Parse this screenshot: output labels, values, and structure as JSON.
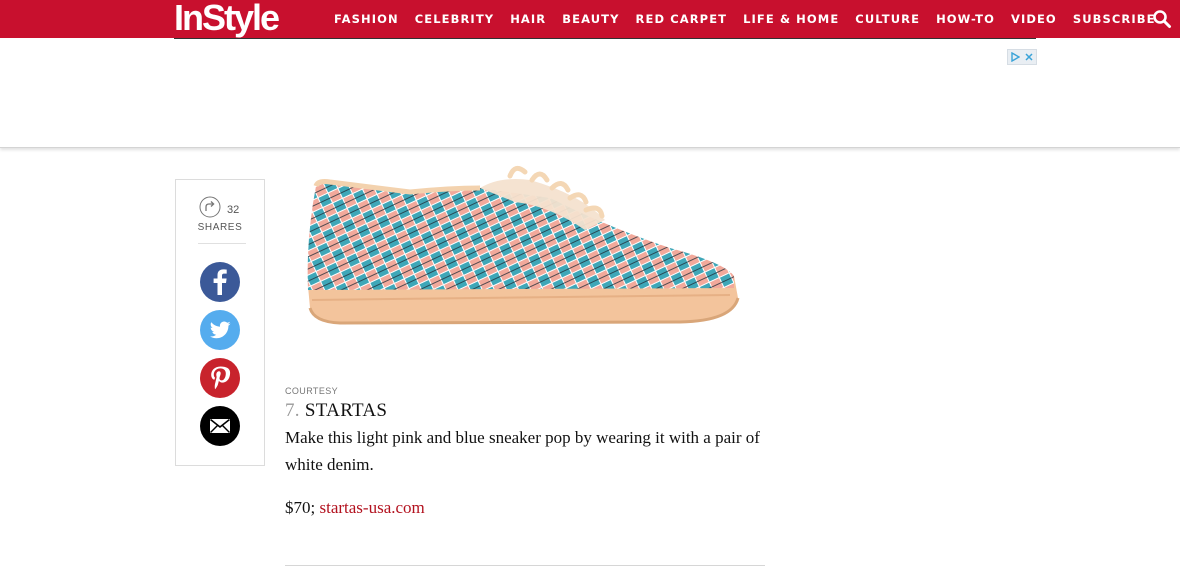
{
  "header": {
    "logo_text": "InStyle",
    "brand_color": "#c8102e",
    "nav": [
      "FASHION",
      "CELEBRITY",
      "HAIR",
      "BEAUTY",
      "RED CARPET",
      "LIFE & HOME",
      "CULTURE",
      "HOW-TO",
      "VIDEO",
      "SUBSCRIBE"
    ],
    "search_icon": "search-icon"
  },
  "ad": {
    "adchoices_icon": "adchoices-icon",
    "close_icon": "close-icon"
  },
  "share": {
    "count": "32",
    "label": "SHARES",
    "share_icon": "share-arrow-icon",
    "networks": [
      {
        "name": "facebook-icon",
        "color": "#3b5998"
      },
      {
        "name": "twitter-icon",
        "color": "#55acee"
      },
      {
        "name": "pinterest-icon",
        "color": "#c8232c"
      },
      {
        "name": "email-icon",
        "color": "#000000"
      }
    ]
  },
  "product": {
    "image_credit": "COURTESY",
    "number": "7.",
    "brand": "STARTAS",
    "description": "Make this light pink and blue sneaker pop by wearing it with a pair of white denim.",
    "price": "$70;",
    "link_text": "startas-usa.com",
    "link_color": "#b3121f"
  }
}
